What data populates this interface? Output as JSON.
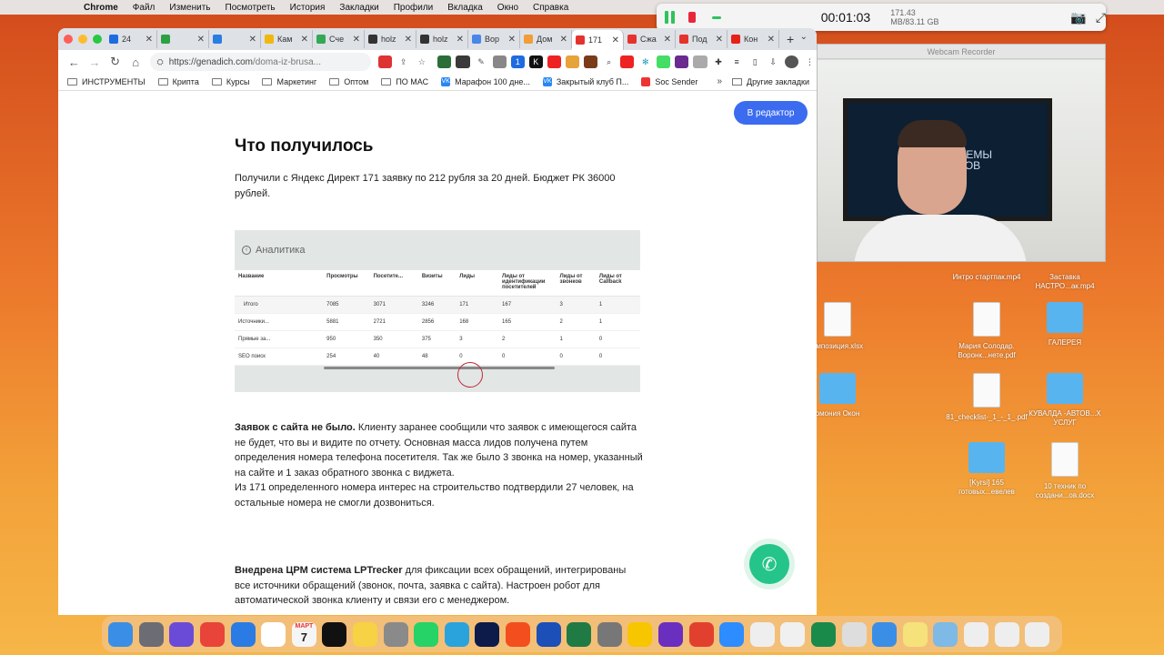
{
  "menubar": {
    "items": [
      "Chrome",
      "Файл",
      "Изменить",
      "Посмотреть",
      "История",
      "Закладки",
      "Профили",
      "Вкладка",
      "Окно",
      "Справка"
    ]
  },
  "recorder": {
    "timer": "00:01:03",
    "size": "171.43 MB/83.11 GB"
  },
  "webcam": {
    "title": "Webcam Recorder",
    "tv_text": "ТЕМЫ\nГОВ"
  },
  "tabs": [
    {
      "label": "24",
      "color": "#1d6ce0"
    },
    {
      "label": "",
      "color": "#2ea043"
    },
    {
      "label": "",
      "color": "#2a7de1"
    },
    {
      "label": "Кам",
      "color": "#f2b70f"
    },
    {
      "label": "Сче",
      "color": "#34a853"
    },
    {
      "label": "holz",
      "color": "#333"
    },
    {
      "label": "holz",
      "color": "#333"
    },
    {
      "label": "Вор",
      "color": "#4a86e8"
    },
    {
      "label": "Дом",
      "color": "#f29d38"
    },
    {
      "label": "171 ",
      "color": "#e5322d",
      "active": true
    },
    {
      "label": "Сжа",
      "color": "#e5322d"
    },
    {
      "label": "Под",
      "color": "#e5322d"
    },
    {
      "label": "Кон",
      "color": "#e62117"
    }
  ],
  "toolbar": {
    "url": "https://genadich.com",
    "url_path": "/doma-iz-brusa..."
  },
  "bookmarks": {
    "items": [
      "ИНСТРУМЕНТЫ",
      "Крипта",
      "Курсы",
      "Маркетинг",
      "Оптом",
      "ПО МАС",
      "Марафон 100 дне...",
      "Закрытый клуб П...",
      "Soc Sender"
    ],
    "other": "Другие закладки"
  },
  "page": {
    "editor_button": "В редактор",
    "heading": "Что получилось",
    "intro": "Получили с Яндекс Директ 171 заявку по 212 рубля за 20 дней. Бюджет РК 36000 рублей.",
    "analytics_title": "Аналитика",
    "p1_bold": "Заявок с сайта не было.",
    "p1": " Клиенту заранее сообщили что заявок с имеющегося сайта не будет, что вы и видите по отчету. Основная масса лидов получена путем определения номера телефона посетителя. Так же было 3 звонка на номер, указанный на сайте и 1 заказ обратного звонка с виджета.",
    "p1b": "Из 171 определенного номера интерес на строительство подтвердили 27 человек, на остальные номера не смогли дозвониться.",
    "p2_bold": "Внедрена ЦРМ система LPTrecker",
    "p2": " для фиксации всех обращений, интегрированы все источники обращений (звонок, почта, заявка с сайта). Настроен робот для автоматической звонка клиенту и связи его с менеджером."
  },
  "analytics_table": {
    "headers": [
      "Название",
      "Просмотры",
      "Посетите...",
      "Визиты",
      "Лиды",
      "Лиды от идентификации посетителей",
      "Лиды от звонков",
      "Лиды от Callback"
    ],
    "rows": [
      [
        "Итого",
        "7085",
        "3071",
        "3246",
        "171",
        "167",
        "3",
        "1"
      ],
      [
        "Источники...",
        "5881",
        "2721",
        "2856",
        "168",
        "165",
        "2",
        "1"
      ],
      [
        "Прямые за...",
        "950",
        "350",
        "375",
        "3",
        "2",
        "1",
        "0"
      ],
      [
        "SEO поиск",
        "254",
        "40",
        "48",
        "0",
        "0",
        "0",
        "0"
      ]
    ]
  },
  "desktop": {
    "items": [
      {
        "label": "Интро стартпак.mp4",
        "type": "video"
      },
      {
        "label": "Заставка НАСТРО...ак.mp4",
        "type": "video"
      },
      {
        "label": "омпозиция.xlsx",
        "type": "doc"
      },
      {
        "label": "Мария Солодар. Воронк...нете.pdf",
        "type": "doc"
      },
      {
        "label": "ГАЛЕРЕЯ",
        "type": "folder"
      },
      {
        "label": "омония Окон",
        "type": "folder"
      },
      {
        "label": "81_checklist-_1_-_1_.pdf",
        "type": "doc"
      },
      {
        "label": "КУВАЛДА -АВТОВ...Х УСЛУГ",
        "type": "folder"
      },
      {
        "label": "[Kyrsi] 165 готовых...евелев",
        "type": "folder"
      },
      {
        "label": "10 техник по создани...ов.docx",
        "type": "doc"
      }
    ]
  },
  "dock": {
    "calendar_month": "МАРТ",
    "calendar_day": "7"
  }
}
